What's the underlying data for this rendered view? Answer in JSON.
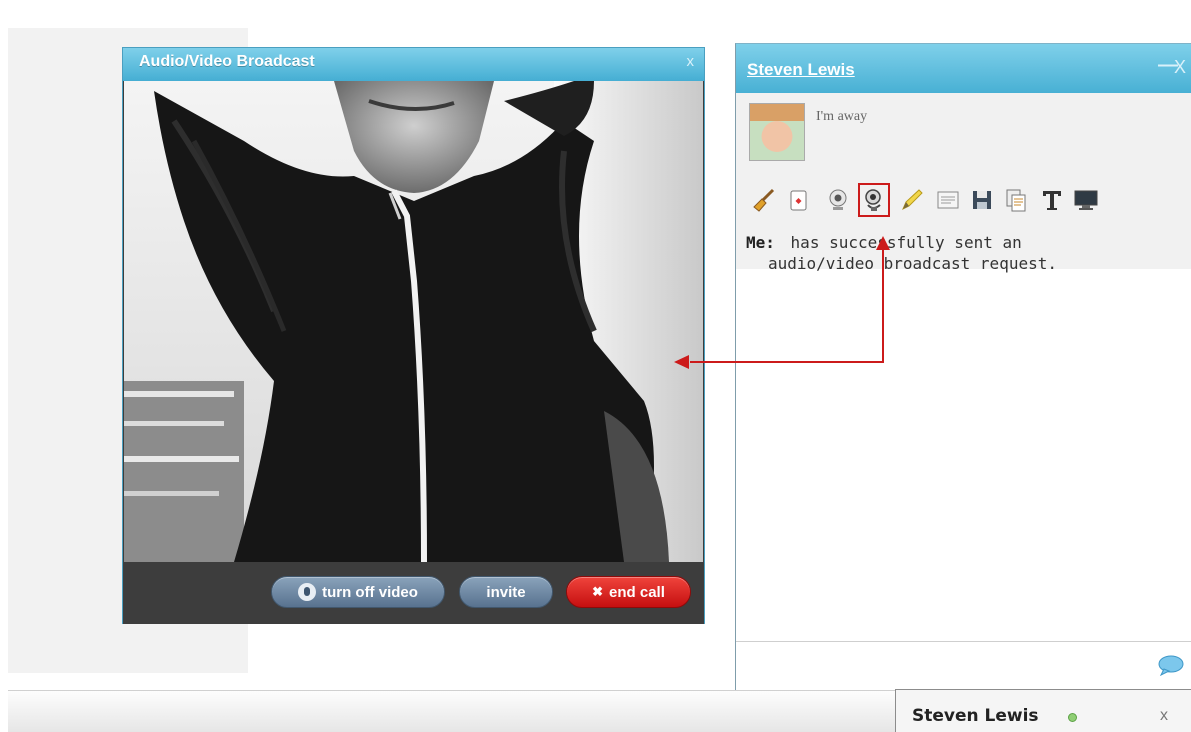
{
  "video_window": {
    "title": "Audio/Video Broadcast",
    "close_glyph": "x",
    "controls": {
      "turn_off_video_label": "turn off video",
      "invite_label": "invite",
      "end_call_label": "end call",
      "end_call_glyph": "✖"
    }
  },
  "chat_window": {
    "contact_name": "Steven Lewis",
    "minimize_glyph": "—",
    "close_glyph": "X",
    "status_text": "I'm away",
    "toolbar": [
      {
        "icon": "broom-icon"
      },
      {
        "icon": "card-icon"
      },
      {
        "icon": "webcam-icon"
      },
      {
        "icon": "audio-video-broadcast-icon",
        "active": true
      },
      {
        "icon": "pencil-icon"
      },
      {
        "icon": "text-window-icon"
      },
      {
        "icon": "save-icon"
      },
      {
        "icon": "copy-icon"
      },
      {
        "icon": "font-icon"
      },
      {
        "icon": "monitor-icon"
      }
    ],
    "message": {
      "sender": "Me:",
      "line1": "has successfully sent an",
      "line2": "audio/video broadcast request."
    }
  },
  "bottom_bar": {
    "tab_name": "Steven Lewis",
    "close_glyph": "x"
  },
  "colors": {
    "titlebar": "#48b0d4",
    "annotation": "#cc1b1b",
    "end_call": "#d8181a"
  }
}
